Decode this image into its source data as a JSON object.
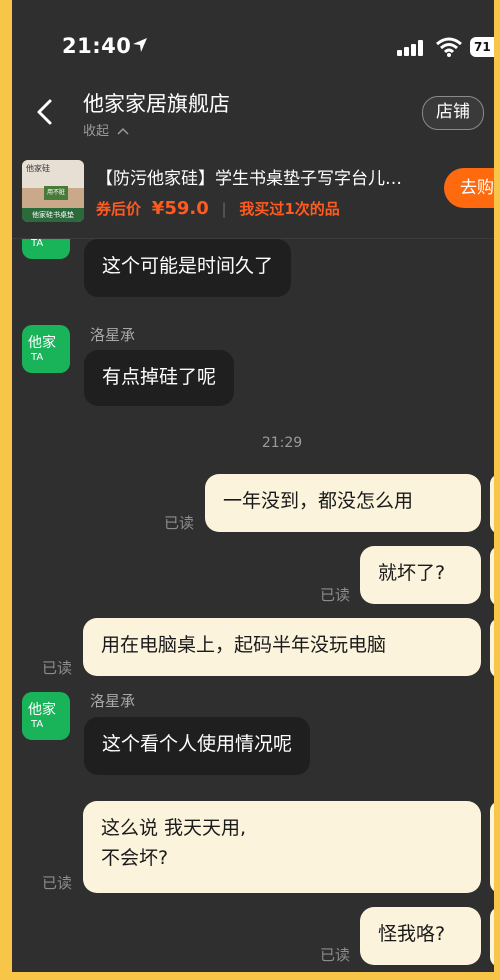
{
  "status_bar": {
    "time": "21:40",
    "battery": "71"
  },
  "nav": {
    "shop_name": "他家家居旗舰店",
    "collapse": "收起",
    "store_button": "店铺"
  },
  "product": {
    "title": "【防污他家硅】学生书桌垫子写字台儿…",
    "price_label": "券后价",
    "price": "¥59.0",
    "bought": "我买过1次的品",
    "buy_button": "去购",
    "thumb_top": "他家硅",
    "thumb_mid": "用不脏",
    "thumb_bottom": "他家硅书桌垫"
  },
  "avatar": {
    "line1": "他家",
    "line2": "TA"
  },
  "messages": [
    {
      "side": "in",
      "text": "这个可能是时间久了"
    },
    {
      "side": "in",
      "sender": "洛星承",
      "text": "有点掉硅了呢"
    },
    {
      "timestamp": "21:29"
    },
    {
      "side": "out",
      "text": "一年没到，都没怎么用",
      "read": "已读"
    },
    {
      "side": "out",
      "text": "就坏了?",
      "read": "已读"
    },
    {
      "side": "out",
      "text": "用在电脑桌上，起码半年没玩电脑",
      "read": "已读"
    },
    {
      "side": "in",
      "sender": "洛星承",
      "text": "这个看个人使用情况呢"
    },
    {
      "side": "out",
      "text_line1": "这么说 我天天用,",
      "text_line2": "不会坏?",
      "read": "已读"
    },
    {
      "side": "out",
      "text": "怪我咯?",
      "read": "已读"
    }
  ],
  "colors": {
    "bg": "#2f2f2f",
    "accent": "#ff6a0f",
    "avatar": "#19b35a",
    "frame": "#f7c548"
  }
}
